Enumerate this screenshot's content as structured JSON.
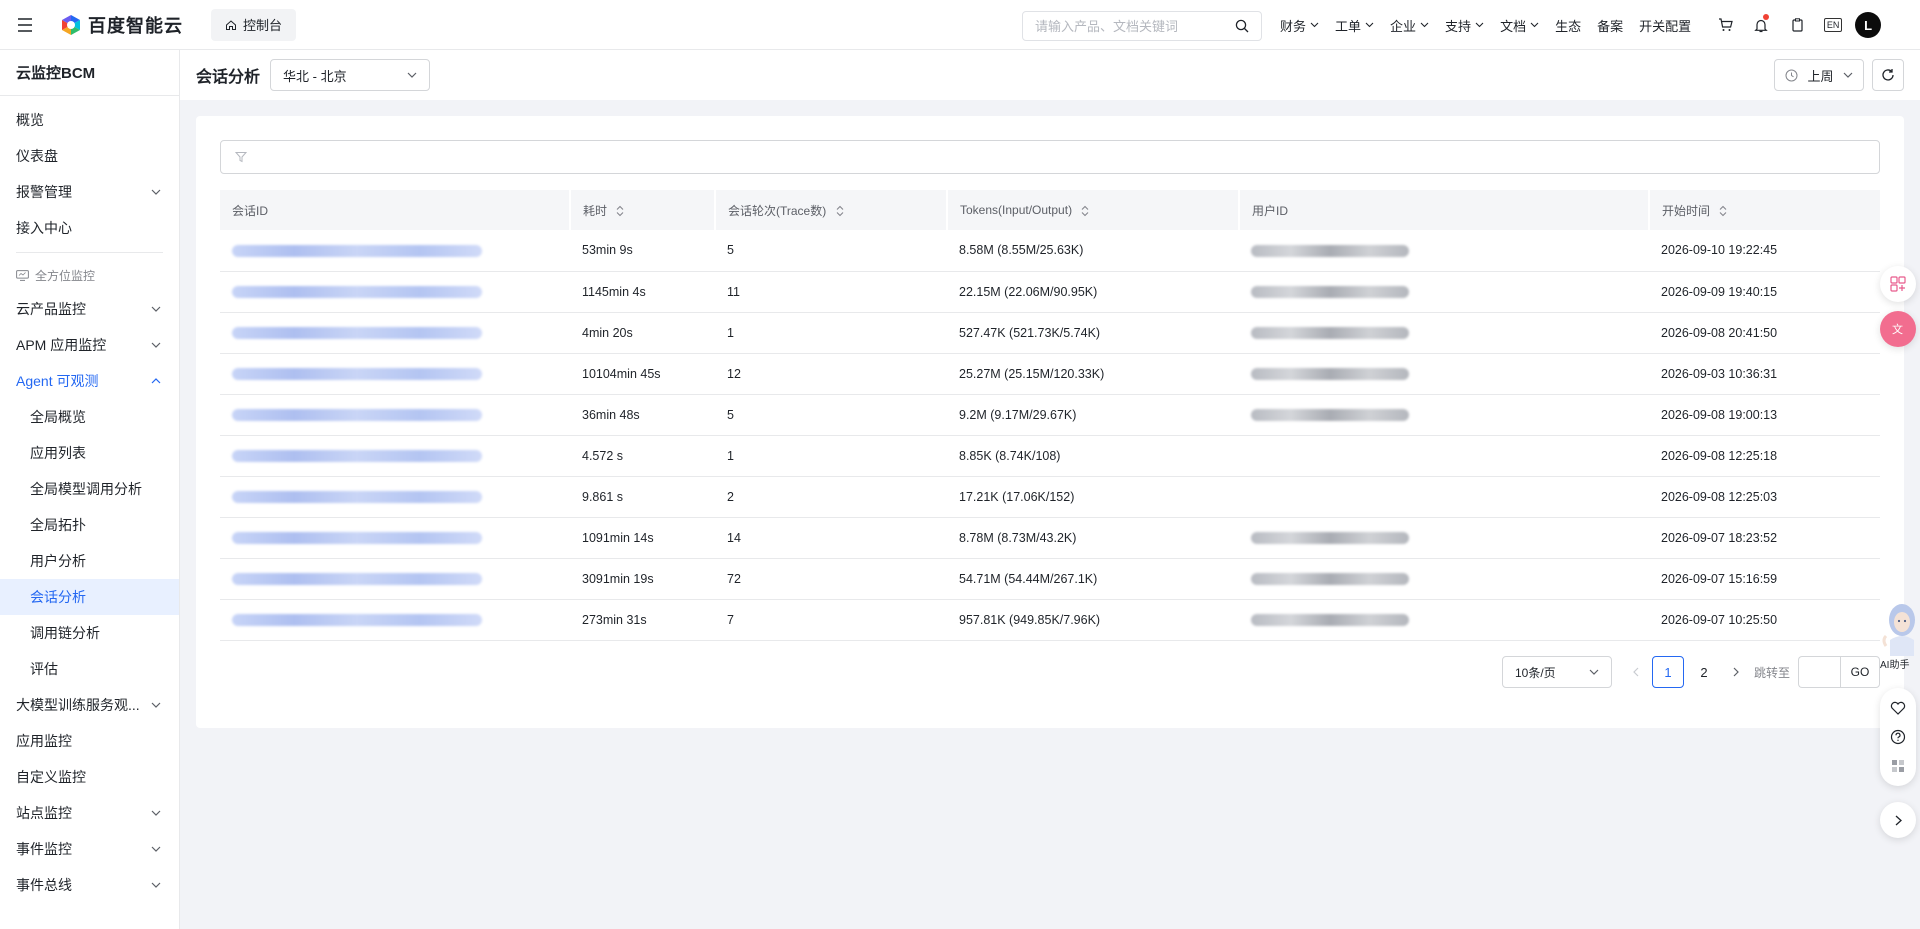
{
  "topbar": {
    "logo_text": "百度智能云",
    "console_label": "控制台",
    "search_placeholder": "请输入产品、文档关键词",
    "nav": [
      {
        "label": "财务",
        "dropdown": true
      },
      {
        "label": "工单",
        "dropdown": true
      },
      {
        "label": "企业",
        "dropdown": true
      },
      {
        "label": "支持",
        "dropdown": true
      },
      {
        "label": "文档",
        "dropdown": true
      },
      {
        "label": "生态",
        "dropdown": false
      },
      {
        "label": "备案",
        "dropdown": false
      },
      {
        "label": "开关配置",
        "dropdown": false
      }
    ],
    "lang_badge": "EN",
    "avatar_letter": "L"
  },
  "sidebar": {
    "title": "云监控BCM",
    "items_top": [
      "概览",
      "仪表盘",
      "报警管理",
      "接入中心"
    ],
    "section_label": "全方位监控",
    "items": [
      {
        "label": "云产品监控",
        "expandable": true
      },
      {
        "label": "APM 应用监控",
        "expandable": true
      },
      {
        "label": "Agent 可观测",
        "expandable": true,
        "open": true
      }
    ],
    "agent_sub": [
      "全局概览",
      "应用列表",
      "全局模型调用分析",
      "全局拓扑",
      "用户分析",
      "会话分析",
      "调用链分析",
      "评估"
    ],
    "active": "会话分析",
    "items_bottom": [
      {
        "label": "大模型训练服务观...",
        "expandable": true
      },
      {
        "label": "应用监控",
        "expandable": false
      },
      {
        "label": "自定义监控",
        "expandable": false
      },
      {
        "label": "站点监控",
        "expandable": true
      },
      {
        "label": "事件监控",
        "expandable": true
      },
      {
        "label": "事件总线",
        "expandable": true
      }
    ]
  },
  "header": {
    "title": "会话分析",
    "region": "华北 - 北京",
    "time_range": "上周"
  },
  "table": {
    "columns": [
      "会话ID",
      "耗时",
      "会话轮次(Trace数)",
      "Tokens(Input/Output)",
      "用户ID",
      "开始时间"
    ],
    "rows": [
      {
        "duration": "53min 9s",
        "turns": "5",
        "tokens": "8.58M (8.55M/25.63K)",
        "has_user": true,
        "start": "2026-09-10 19:22:45"
      },
      {
        "duration": "1145min 4s",
        "turns": "11",
        "tokens": "22.15M (22.06M/90.95K)",
        "has_user": true,
        "start": "2026-09-09 19:40:15"
      },
      {
        "duration": "4min 20s",
        "turns": "1",
        "tokens": "527.47K (521.73K/5.74K)",
        "has_user": true,
        "start": "2026-09-08 20:41:50"
      },
      {
        "duration": "10104min 45s",
        "turns": "12",
        "tokens": "25.27M (25.15M/120.33K)",
        "has_user": true,
        "start": "2026-09-03 10:36:31"
      },
      {
        "duration": "36min 48s",
        "turns": "5",
        "tokens": "9.2M (9.17M/29.67K)",
        "has_user": true,
        "start": "2026-09-08 19:00:13"
      },
      {
        "duration": "4.572 s",
        "turns": "1",
        "tokens": "8.85K (8.74K/108)",
        "has_user": false,
        "start": "2026-09-08 12:25:18"
      },
      {
        "duration": "9.861 s",
        "turns": "2",
        "tokens": "17.21K (17.06K/152)",
        "has_user": false,
        "start": "2026-09-08 12:25:03"
      },
      {
        "duration": "1091min 14s",
        "turns": "14",
        "tokens": "8.78M (8.73M/43.2K)",
        "has_user": true,
        "start": "2026-09-07 18:23:52"
      },
      {
        "duration": "3091min 19s",
        "turns": "72",
        "tokens": "54.71M (54.44M/267.1K)",
        "has_user": true,
        "start": "2026-09-07 15:16:59"
      },
      {
        "duration": "273min 31s",
        "turns": "7",
        "tokens": "957.81K (949.85K/7.96K)",
        "has_user": true,
        "start": "2026-09-07 10:25:50"
      }
    ]
  },
  "pagination": {
    "page_size": "10条/页",
    "pages": [
      "1",
      "2"
    ],
    "current": "1",
    "jump_label": "跳转至",
    "go_label": "GO"
  },
  "assistant_label": "AI助手",
  "colors": {
    "accent": "#2468f2",
    "active_bg": "#e8f0ff",
    "notification": "#f04134"
  }
}
